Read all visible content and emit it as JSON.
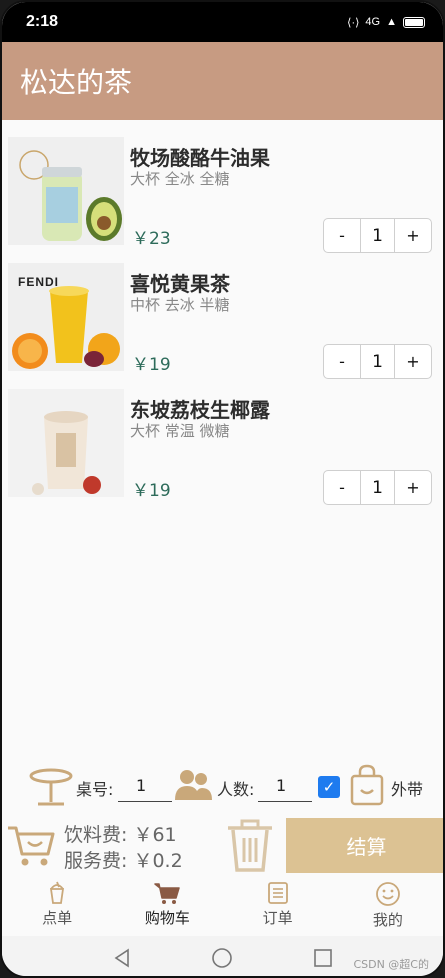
{
  "status_bar": {
    "time": "2:18",
    "signal_text": "4G"
  },
  "header": {
    "title": "松达的茶"
  },
  "cart": {
    "items": [
      {
        "name": "牧场酸酪牛油果",
        "options": "大杯 全冰 全糖",
        "price": "￥23",
        "quantity": "1",
        "image": "avocado-yogurt-drink"
      },
      {
        "name": "喜悦黄果茶",
        "options": "中杯 去冰 半糖",
        "price": "￥19",
        "quantity": "1",
        "image": "mango-orange-tea",
        "brand_text": "FENDI"
      },
      {
        "name": "东坡荔枝生椰露",
        "options": "大杯 常温 微糖",
        "price": "￥19",
        "quantity": "1",
        "image": "lychee-coconut-drink"
      }
    ],
    "minus_label": "-",
    "plus_label": "+"
  },
  "order_options": {
    "table_label": "桌号:",
    "table_value": "1",
    "people_label": "人数:",
    "people_value": "1",
    "takeaway_label": "外带",
    "takeaway_checked": true
  },
  "checkout": {
    "drink_fee_label": "饮料费:",
    "drink_fee_value": "￥61",
    "service_fee_label": "服务费:",
    "service_fee_value": "￥0.2",
    "checkout_label": "结算"
  },
  "tabs": [
    {
      "label": "点单",
      "icon": "drink-icon",
      "active": false
    },
    {
      "label": "购物车",
      "icon": "cart-icon",
      "active": true
    },
    {
      "label": "订单",
      "icon": "order-list-icon",
      "active": false
    },
    {
      "label": "我的",
      "icon": "smile-icon",
      "active": false
    }
  ],
  "watermark": "CSDN @超C的",
  "colors": {
    "header": "#c79b82",
    "accent": "#dcc293",
    "price": "#2d6b5a",
    "checkbox": "#1e7bef"
  }
}
